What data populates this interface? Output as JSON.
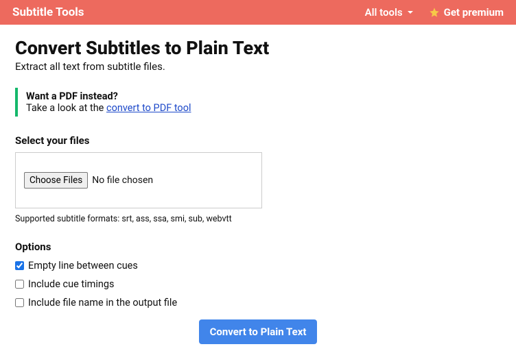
{
  "header": {
    "brand": "Subtitle Tools",
    "all_tools": "All tools",
    "get_premium": "Get premium"
  },
  "main": {
    "title": "Convert Subtitles to Plain Text",
    "subtitle": "Extract all text from subtitle files.",
    "callout": {
      "title": "Want a PDF instead?",
      "prefix": "Take a look at the ",
      "link_text": "convert to PDF tool"
    },
    "files": {
      "label": "Select your files",
      "choose_btn": "Choose Files",
      "status": "No file chosen",
      "supported": "Supported subtitle formats: srt, ass, ssa, smi, sub, webvtt"
    },
    "options": {
      "label": "Options",
      "items": [
        {
          "label": "Empty line between cues",
          "checked": true
        },
        {
          "label": "Include cue timings",
          "checked": false
        },
        {
          "label": "Include file name in the output file",
          "checked": false
        }
      ]
    },
    "submit": "Convert to Plain Text"
  }
}
